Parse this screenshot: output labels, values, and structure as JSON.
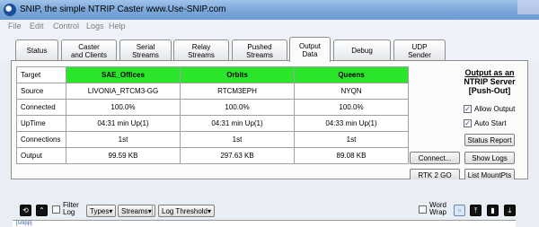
{
  "window": {
    "title": "SNIP, the simple NTRIP Caster www.Use-SNIP.com"
  },
  "menu": {
    "items": [
      "File",
      "Edit",
      "Control",
      "Logs",
      "Help"
    ]
  },
  "tabs": [
    {
      "label": "Status"
    },
    {
      "label": "Caster\nand Clients"
    },
    {
      "label": "Serial\nStreams"
    },
    {
      "label": "Relay\nStreams"
    },
    {
      "label": "Pushed\nStreams"
    },
    {
      "label": "Output\nData"
    },
    {
      "label": "Debug"
    },
    {
      "label": "UDP\nSender"
    }
  ],
  "active_tab": "Output\nData",
  "grid": {
    "row_labels": [
      "Target",
      "Source",
      "Connected",
      "UpTime",
      "Connections",
      "Output"
    ],
    "columns": [
      {
        "target": "SAE_Offices",
        "source": "LIVONIA_RTCM3-GG",
        "connected": "100.0%",
        "uptime": "04:31 min Up(1)",
        "connections": "1st",
        "output": "99.59 KB"
      },
      {
        "target": "Orbits",
        "source": "RTCM3EPH",
        "connected": "100.0%",
        "uptime": "04:31 min Up(1)",
        "connections": "1st",
        "output": "297.63 KB"
      },
      {
        "target": "Queens",
        "source": "NYQN",
        "connected": "100.0%",
        "uptime": "04:33 min Up(1)",
        "connections": "1st",
        "output": "89.08 KB"
      }
    ],
    "header_color": "#2be52b"
  },
  "side": {
    "heading_line1": "Output as an",
    "heading_line2": "NTRIP Server",
    "heading_line3": "[Push-Out]",
    "allow_output_label": "Allow Output",
    "allow_output_checked": true,
    "auto_start_label": "Auto Start",
    "auto_start_checked": true,
    "status_report_label": "Status Report",
    "connect_label": "Connect...",
    "show_logs_label": "Show Logs",
    "rtk2go_label": "RTK 2 GO",
    "list_mountpts_label": "List MountPts"
  },
  "bottom_bar": {
    "filter_log_label": "Filter\nLog",
    "types_label": "Types",
    "streams_label": "Streams",
    "log_threshold_label": "Log Threshold",
    "word_wrap_label": "Word\nWrap",
    "log_text": "[snipp]"
  }
}
